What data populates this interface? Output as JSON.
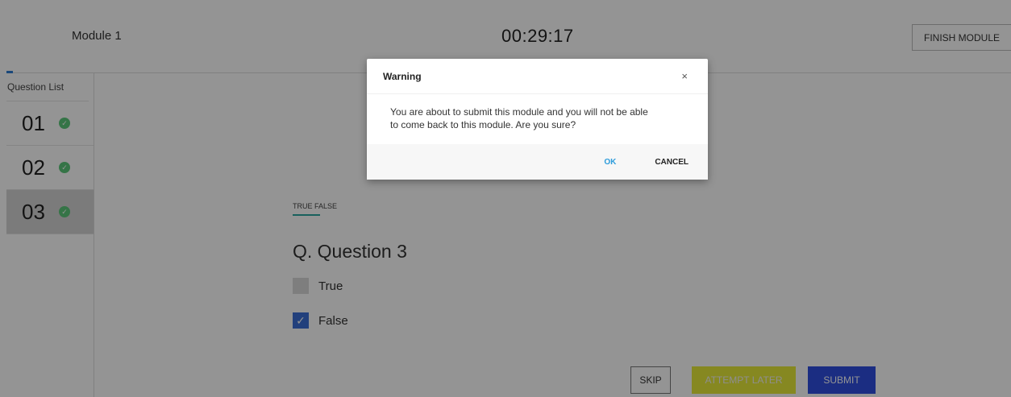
{
  "header": {
    "module_title": "Module 1",
    "timer": "00:29:17",
    "finish_button": "FINISH MODULE"
  },
  "sidebar": {
    "title": "Question List",
    "questions": [
      {
        "number": "01",
        "answered": true,
        "active": false
      },
      {
        "number": "02",
        "answered": true,
        "active": false
      },
      {
        "number": "03",
        "answered": true,
        "active": true
      }
    ],
    "check_icon": "check-circle-icon"
  },
  "question": {
    "type_label": "TRUE FALSE",
    "text": "Q. Question 3",
    "options": [
      {
        "label": "True",
        "checked": false
      },
      {
        "label": "False",
        "checked": true
      }
    ]
  },
  "actions": {
    "skip": "SKIP",
    "attempt_later": "ATTEMPT LATER",
    "submit": "SUBMIT"
  },
  "modal": {
    "title": "Warning",
    "close_glyph": "×",
    "message_line1": "You are about to submit this module and you will not be able",
    "message_line2": "to come back to this module. Are you sure?",
    "ok": "OK",
    "cancel": "CANCEL"
  },
  "colors": {
    "check_green": "#5cc97a",
    "submit_blue": "#2f4fe0",
    "attempt_later_yellow": "#e7ea3a",
    "ok_blue": "#2d9cdb"
  }
}
